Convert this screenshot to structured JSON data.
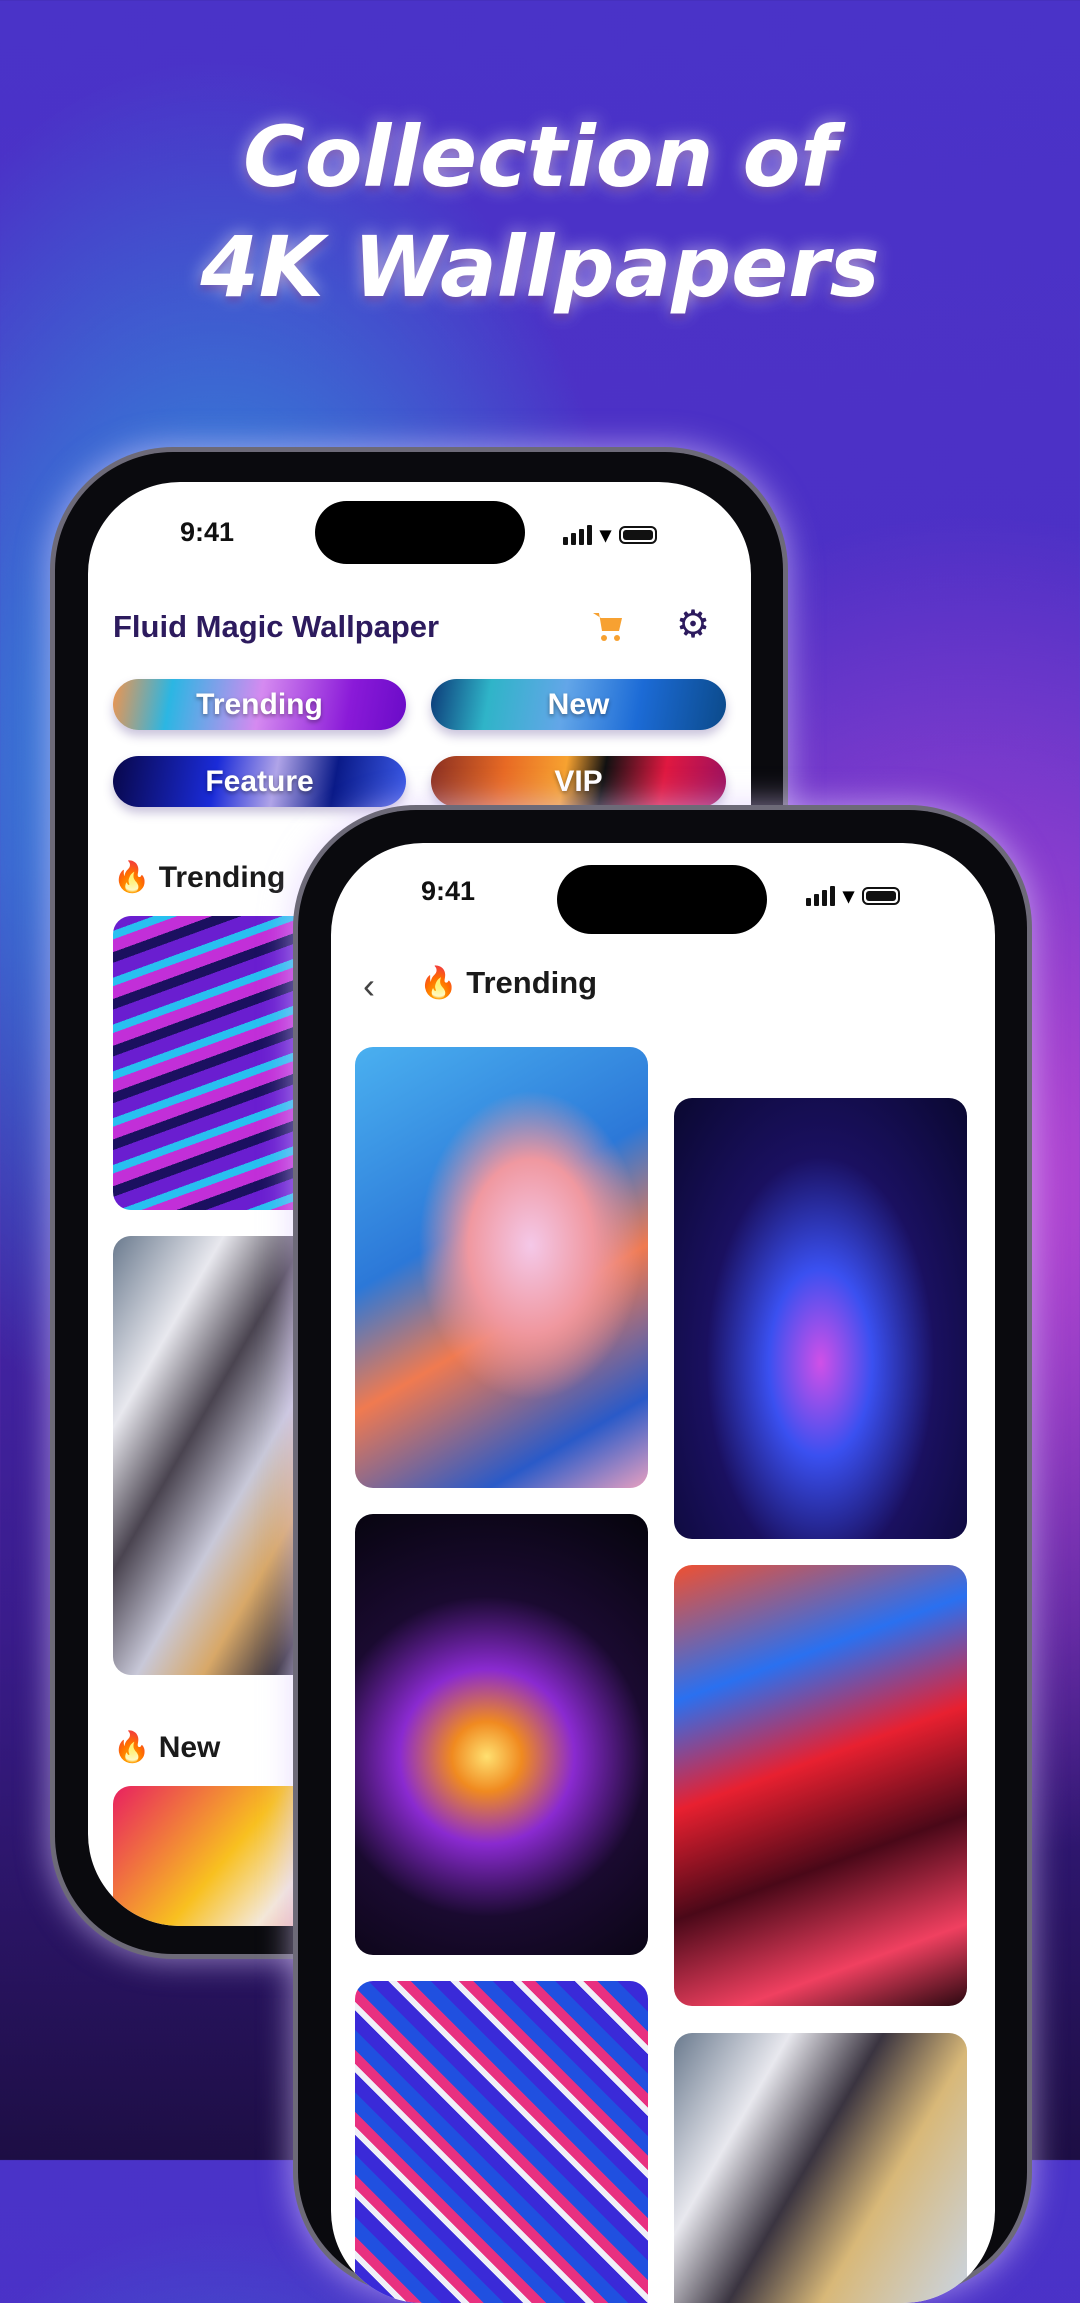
{
  "headline": {
    "line1": "Collection of",
    "line2": "4K Wallpapers"
  },
  "back_phone": {
    "status": {
      "time": "9:41"
    },
    "header": {
      "title": "Fluid Magic Wallpaper",
      "cart_icon": "cart-icon",
      "settings_icon": "gear-icon"
    },
    "categories": [
      {
        "label": "Trending"
      },
      {
        "label": "New"
      },
      {
        "label": "Feature"
      },
      {
        "label": "VIP"
      }
    ],
    "sections": [
      {
        "emoji": "🔥",
        "title": "Trending"
      },
      {
        "emoji": "🔥",
        "title": "New"
      }
    ]
  },
  "front_phone": {
    "status": {
      "time": "9:41"
    },
    "header": {
      "back_icon": "chevron-left-icon",
      "emoji": "🔥",
      "title": "Trending"
    }
  },
  "colors": {
    "title": "#2d1b5e",
    "cart": "#f7a131",
    "gear": "#2d1b5e"
  }
}
